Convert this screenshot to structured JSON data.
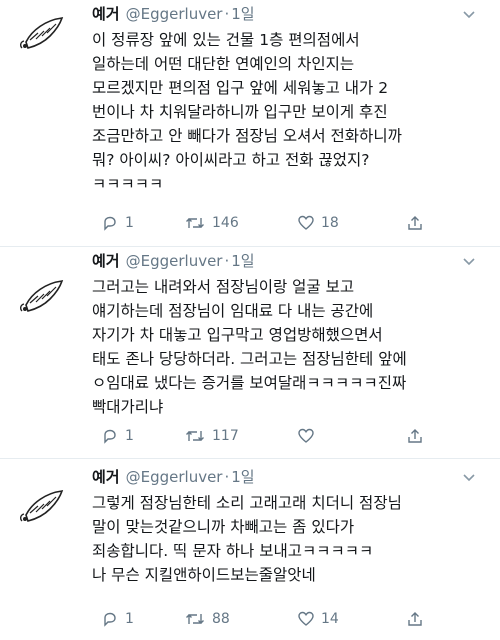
{
  "tweets": [
    {
      "name": "예거",
      "handle": "@Eggerluver",
      "time": "1일",
      "lines": [
        "이 정류장 앞에 있는 건물 1층 편의점에서",
        "일하는데 어떤 대단한 연예인의 차인지는",
        "모르겠지만 편의점 입구 앞에 세워놓고 내가 2",
        "번이나 차 치워달라하니까 입구만 보이게 후진",
        "조금만하고 안 빼다가 점장님 오셔서 전화하니까",
        "뭐? 아이씨? 아이씨라고 하고 전화 끊었지?",
        "ㅋㅋㅋㅋㅋ"
      ],
      "replies": "1",
      "retweets": "146",
      "likes": "18"
    },
    {
      "name": "예거",
      "handle": "@Eggerluver",
      "time": "1일",
      "lines": [
        "그러고는 내려와서 점장님이랑 얼굴 보고",
        "얘기하는데 점장님이 임대료 다 내는 공간에",
        "자기가 차 대놓고 입구막고 영업방해했으면서",
        "태도 존나 당당하더라. 그러고는 점장님한테 앞에",
        "ㅇ임대료 냈다는 증거를 보여달래ㅋㅋㅋㅋㅋ진짜",
        "빡대가리냐"
      ],
      "replies": "1",
      "retweets": "117",
      "likes": ""
    },
    {
      "name": "예거",
      "handle": "@Eggerluver",
      "time": "1일",
      "lines": [
        "그렇게 점장님한테 소리 고래고래 치더니 점장님",
        "말이 맞는것같으니까 차빼고는 좀 있다가",
        "죄송합니다. 띡 문자 하나 보내고ㅋㅋㅋㅋㅋ",
        "나 무슨 지킬앤하이드보는줄알앗네"
      ],
      "replies": "1",
      "retweets": "88",
      "likes": "14"
    }
  ],
  "icons": {
    "avatar": "doodle-avatar-icon",
    "caret": "chevron-down-icon",
    "reply": "reply-icon",
    "retweet": "retweet-icon",
    "like": "heart-icon",
    "share": "share-icon"
  },
  "colors": {
    "text": "#14171a",
    "secondary": "#657786",
    "divider": "#e6ecf0"
  }
}
